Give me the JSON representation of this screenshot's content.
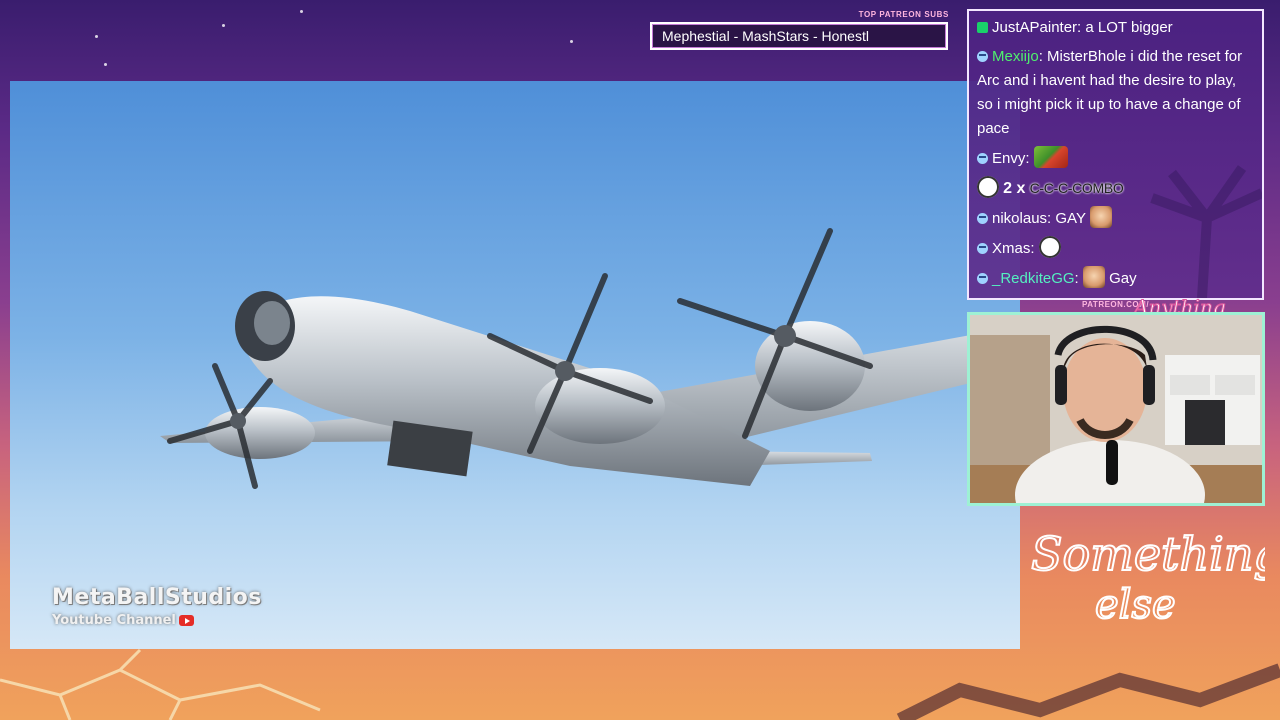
{
  "video": {
    "watermark_title": "MetaBallStudios",
    "watermark_sub": "Youtube Channel"
  },
  "ticker": {
    "label": "TOP PATREON SUBS",
    "text": "Mephestial - MashStars - Honestl"
  },
  "chat": {
    "messages": [
      {
        "user": "JustAPainter",
        "text": "a LOT bigger"
      },
      {
        "user": "Mexiijo",
        "text": "MisterBhole i did the reset for Arc and i havent had the desire to play, so i might pick it up to have a change of pace"
      },
      {
        "user": "Envy",
        "text": ""
      },
      {
        "combo_count": "2 x",
        "combo_text": "C-C-C-COMBO"
      },
      {
        "user": "nikolaus",
        "text": "GAY"
      },
      {
        "user": "Xmas",
        "text": ""
      },
      {
        "user": "_RedkiteGG",
        "text": "Gay"
      }
    ]
  },
  "cam": {
    "tag": "PATREON.COM/",
    "signature_top": "Anything",
    "signature_bottom": "else"
  },
  "overlay": {
    "brand_line1": "Something",
    "brand_line2": "else"
  }
}
